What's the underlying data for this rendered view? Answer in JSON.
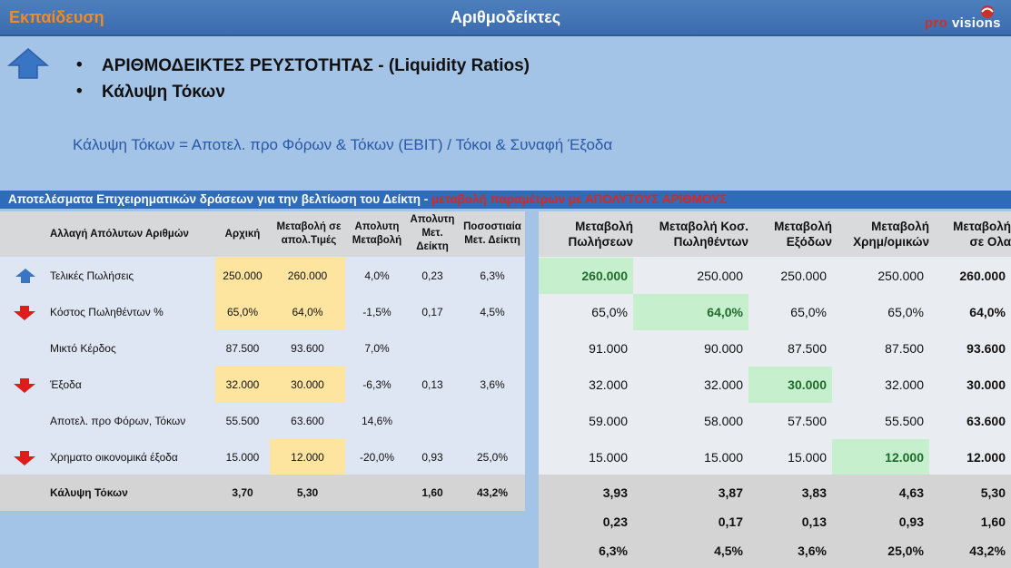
{
  "header": {
    "section": "Εκπαίδευση",
    "title": "Αριθμοδείκτες",
    "logo": {
      "pro": "pro",
      "visions": "visions"
    }
  },
  "bullets": [
    "ΑΡΙΘΜΟΔΕΙΚΤΕΣ ΡΕΥΣΤΟΤΗΤΑΣ - (Liquidity Ratios)",
    "Κάλυψη Τόκων"
  ],
  "formula": "Κάλυψη Τόκων = Αποτελ. προ Φόρων & Τόκων (EBIT) / Τόκοι & Συναφή Έξοδα",
  "banner": {
    "text": "Αποτελέσματα Επιχειρηματικών δράσεων για την βελτίωση του Δείκτη -",
    "highlight": "μεταβολή παραμέτρων με ΑΠΟΛΥΤΟΥΣ ΑΡΙΘΜΟΥΣ"
  },
  "left_table": {
    "headers": [
      "Αλλαγή Απόλυτων Αριθμών",
      "Αρχική",
      "Μεταβολή σε απολ.Τιμές",
      "Απολυτη Μεταβολή",
      "Απολυτη Μετ. Δείκτη",
      "Ποσοστιαία Μετ. Δείκτη"
    ],
    "rows": [
      {
        "arrow": "up",
        "label": "Τελικές Πωλήσεις",
        "initial": "250.000",
        "changed": "260.000",
        "abs": "4,0%",
        "idx": "0,23",
        "pct": "6,3%"
      },
      {
        "arrow": "down",
        "label": "Κόστος Πωληθέντων %",
        "initial": "65,0%",
        "changed": "64,0%",
        "abs": "-1,5%",
        "idx": "0,17",
        "pct": "4,5%"
      },
      {
        "arrow": "",
        "label": "Μικτό  Κέρδος",
        "initial": "87.500",
        "changed": "93.600",
        "abs": "7,0%",
        "idx": "",
        "pct": ""
      },
      {
        "arrow": "down",
        "label": "Έξοδα",
        "initial": "32.000",
        "changed": "30.000",
        "abs": "-6,3%",
        "idx": "0,13",
        "pct": "3,6%"
      },
      {
        "arrow": "",
        "label": "Αποτελ. προ Φόρων,  Τόκων",
        "initial": "55.500",
        "changed": "63.600",
        "abs": "14,6%",
        "idx": "",
        "pct": ""
      },
      {
        "arrow": "down",
        "label": "Χρηματο οικονομικά  έξοδα",
        "initial": "15.000",
        "changed": "12.000",
        "abs": "-20,0%",
        "idx": "0,93",
        "pct": "25,0%"
      }
    ],
    "footer": {
      "label": "Κάλυψη Τόκων",
      "initial": "3,70",
      "changed": "5,30",
      "abs": "",
      "idx": "1,60",
      "pct": "43,2%"
    }
  },
  "right_table": {
    "headers": [
      [
        "Μεταβολή",
        "Πωλήσεων"
      ],
      [
        "Μεταβολή Κοσ.",
        "Πωληθέντων"
      ],
      [
        "Μεταβολή",
        "Εξόδων"
      ],
      [
        "Μεταβολή",
        "Χρημ/ομικών"
      ],
      [
        "Μεταβολή",
        "σε Ολα"
      ]
    ],
    "rows": [
      [
        "260.000",
        "250.000",
        "250.000",
        "250.000",
        "260.000"
      ],
      [
        "65,0%",
        "64,0%",
        "65,0%",
        "65,0%",
        "64,0%"
      ],
      [
        "91.000",
        "90.000",
        "87.500",
        "87.500",
        "93.600"
      ],
      [
        "32.000",
        "32.000",
        "30.000",
        "32.000",
        "30.000"
      ],
      [
        "59.000",
        "58.000",
        "57.500",
        "55.500",
        "63.600"
      ],
      [
        "15.000",
        "15.000",
        "15.000",
        "12.000",
        "12.000"
      ]
    ],
    "footer": [
      [
        "3,93",
        "3,87",
        "3,83",
        "4,63",
        "5,30"
      ],
      [
        "0,23",
        "0,17",
        "0,13",
        "0,93",
        "1,60"
      ],
      [
        "6,3%",
        "4,5%",
        "3,6%",
        "25,0%",
        "43,2%"
      ]
    ]
  },
  "colors": {
    "background": "#a3c3e7",
    "title_bar": "#3b6cae",
    "section_label": "#f28a25",
    "banner": "#2e6bb8",
    "banner_highlight": "#e3241b",
    "input_cell": "#fde49f",
    "changed_cell": "#c6efce",
    "arrow_up": "#3a75c4",
    "arrow_down": "#e11b1b"
  }
}
